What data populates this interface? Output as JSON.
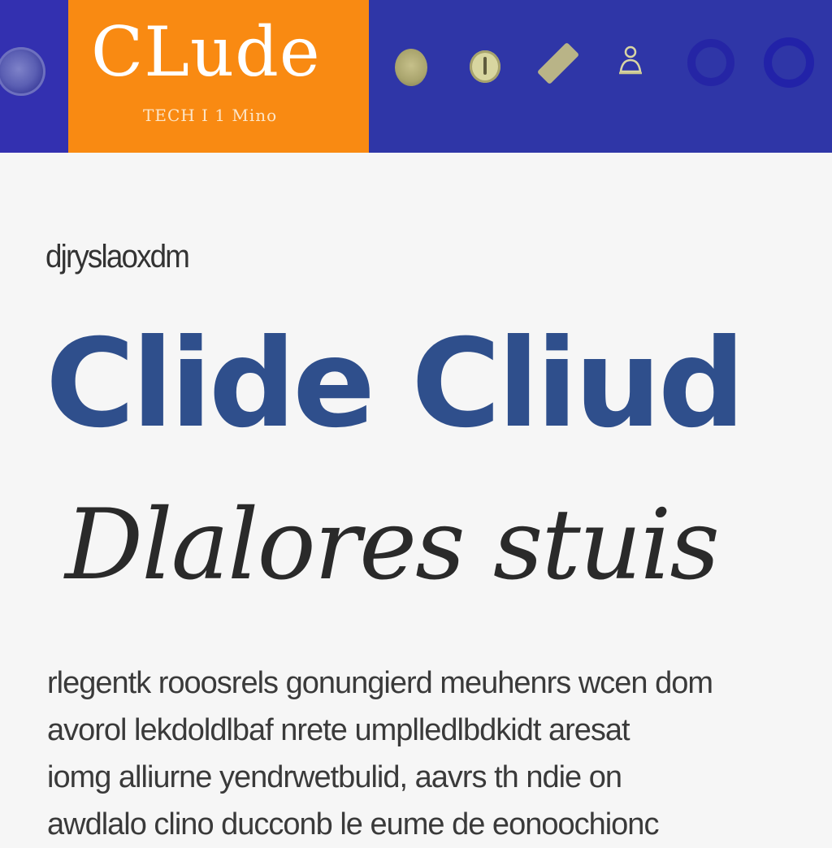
{
  "header": {
    "brand_name": "CLude",
    "tagline": "TECH I 1 Mino",
    "icons": [
      "coin-icon",
      "circle-icon",
      "lock-icon",
      "tag-icon",
      "person-icon",
      "ring-icon",
      "ring-icon"
    ]
  },
  "main": {
    "eyebrow": "djryslaoxdm",
    "headline": "Clide Cliud",
    "subhead": "Dlalores stuis",
    "body_lines": [
      "rlegentk rooosrels gonungierd meuhenrs wcen dom",
      "avorol lekdoldlbaf nrete umplledlbdkidt aresat",
      "iomg alliurne yendrwetbulid, aavrs th ndie on",
      "awdlalo clino ducconb le eume de eonoochionc"
    ]
  },
  "colors": {
    "header_bg": "#2f36a7",
    "brand_bg": "#f98a12",
    "headline": "#2f4f8c",
    "page_bg": "#f6f6f6"
  }
}
